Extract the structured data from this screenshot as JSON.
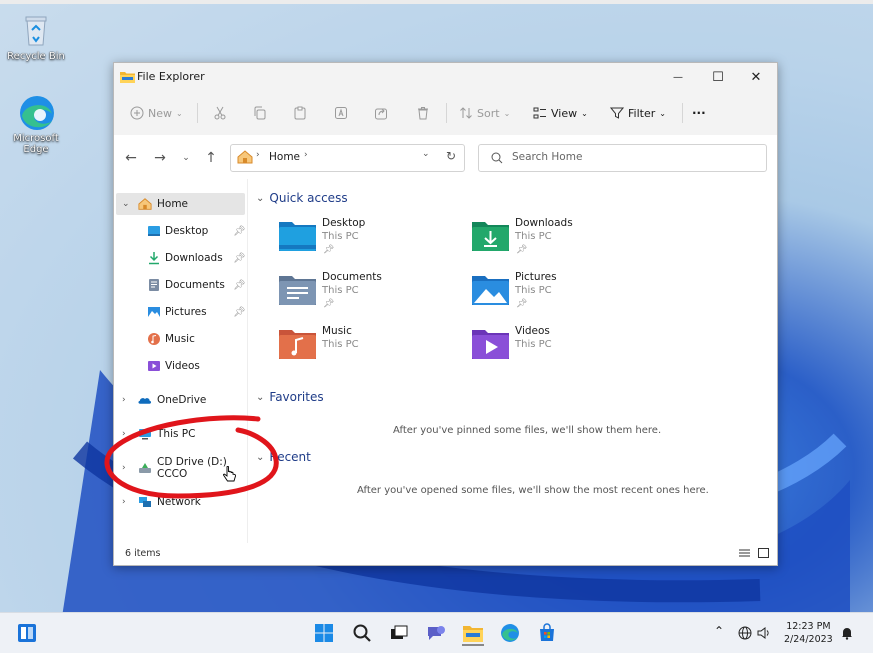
{
  "desktop": {
    "icons": [
      {
        "label": "Recycle Bin",
        "icon": "recycle-bin-icon"
      },
      {
        "label": "Microsoft Edge",
        "icon": "edge-icon"
      }
    ]
  },
  "window": {
    "title": "File Explorer",
    "controls": {
      "minimize": "—",
      "maximize": "☐",
      "close": "✕"
    }
  },
  "toolbar": {
    "new_label": "New",
    "sort_label": "Sort",
    "view_label": "View",
    "filter_label": "Filter",
    "more_label": "···"
  },
  "address": {
    "crumb": "Home",
    "search_placeholder": "Search Home"
  },
  "sidebar": {
    "items": [
      {
        "label": "Home",
        "icon": "home-icon"
      },
      {
        "label": "Desktop",
        "icon": "desktop-icon"
      },
      {
        "label": "Downloads",
        "icon": "download-icon"
      },
      {
        "label": "Documents",
        "icon": "documents-icon"
      },
      {
        "label": "Pictures",
        "icon": "pictures-icon"
      },
      {
        "label": "Music",
        "icon": "music-icon"
      },
      {
        "label": "Videos",
        "icon": "videos-icon"
      },
      {
        "label": "OneDrive",
        "icon": "onedrive-icon"
      },
      {
        "label": "This PC",
        "icon": "this-pc-icon"
      },
      {
        "label": "CD Drive (D:) CCCO",
        "icon": "cd-drive-icon"
      },
      {
        "label": "Network",
        "icon": "network-icon"
      }
    ]
  },
  "content": {
    "quick_access_label": "Quick access",
    "favorites_label": "Favorites",
    "recent_label": "Recent",
    "favorites_empty": "After you've pinned some files, we'll show them here.",
    "recent_empty": "After you've opened some files, we'll show the most recent ones here.",
    "tiles": [
      {
        "name": "Desktop",
        "sub": "This PC",
        "color": "#1fa0e0"
      },
      {
        "name": "Downloads",
        "sub": "This PC",
        "color": "#22a86b"
      },
      {
        "name": "Documents",
        "sub": "This PC",
        "color": "#7d95b3"
      },
      {
        "name": "Pictures",
        "sub": "This PC",
        "color": "#2a8de0"
      },
      {
        "name": "Music",
        "sub": "This PC",
        "color": "#e3704a"
      },
      {
        "name": "Videos",
        "sub": "This PC",
        "color": "#8a4fd8"
      }
    ]
  },
  "status": {
    "item_count": "6 items"
  },
  "taskbar": {
    "time": "12:23 PM",
    "date": "2/24/2023"
  },
  "colors": {
    "accent": "#0067c0",
    "annotation_red": "#e0151b"
  }
}
